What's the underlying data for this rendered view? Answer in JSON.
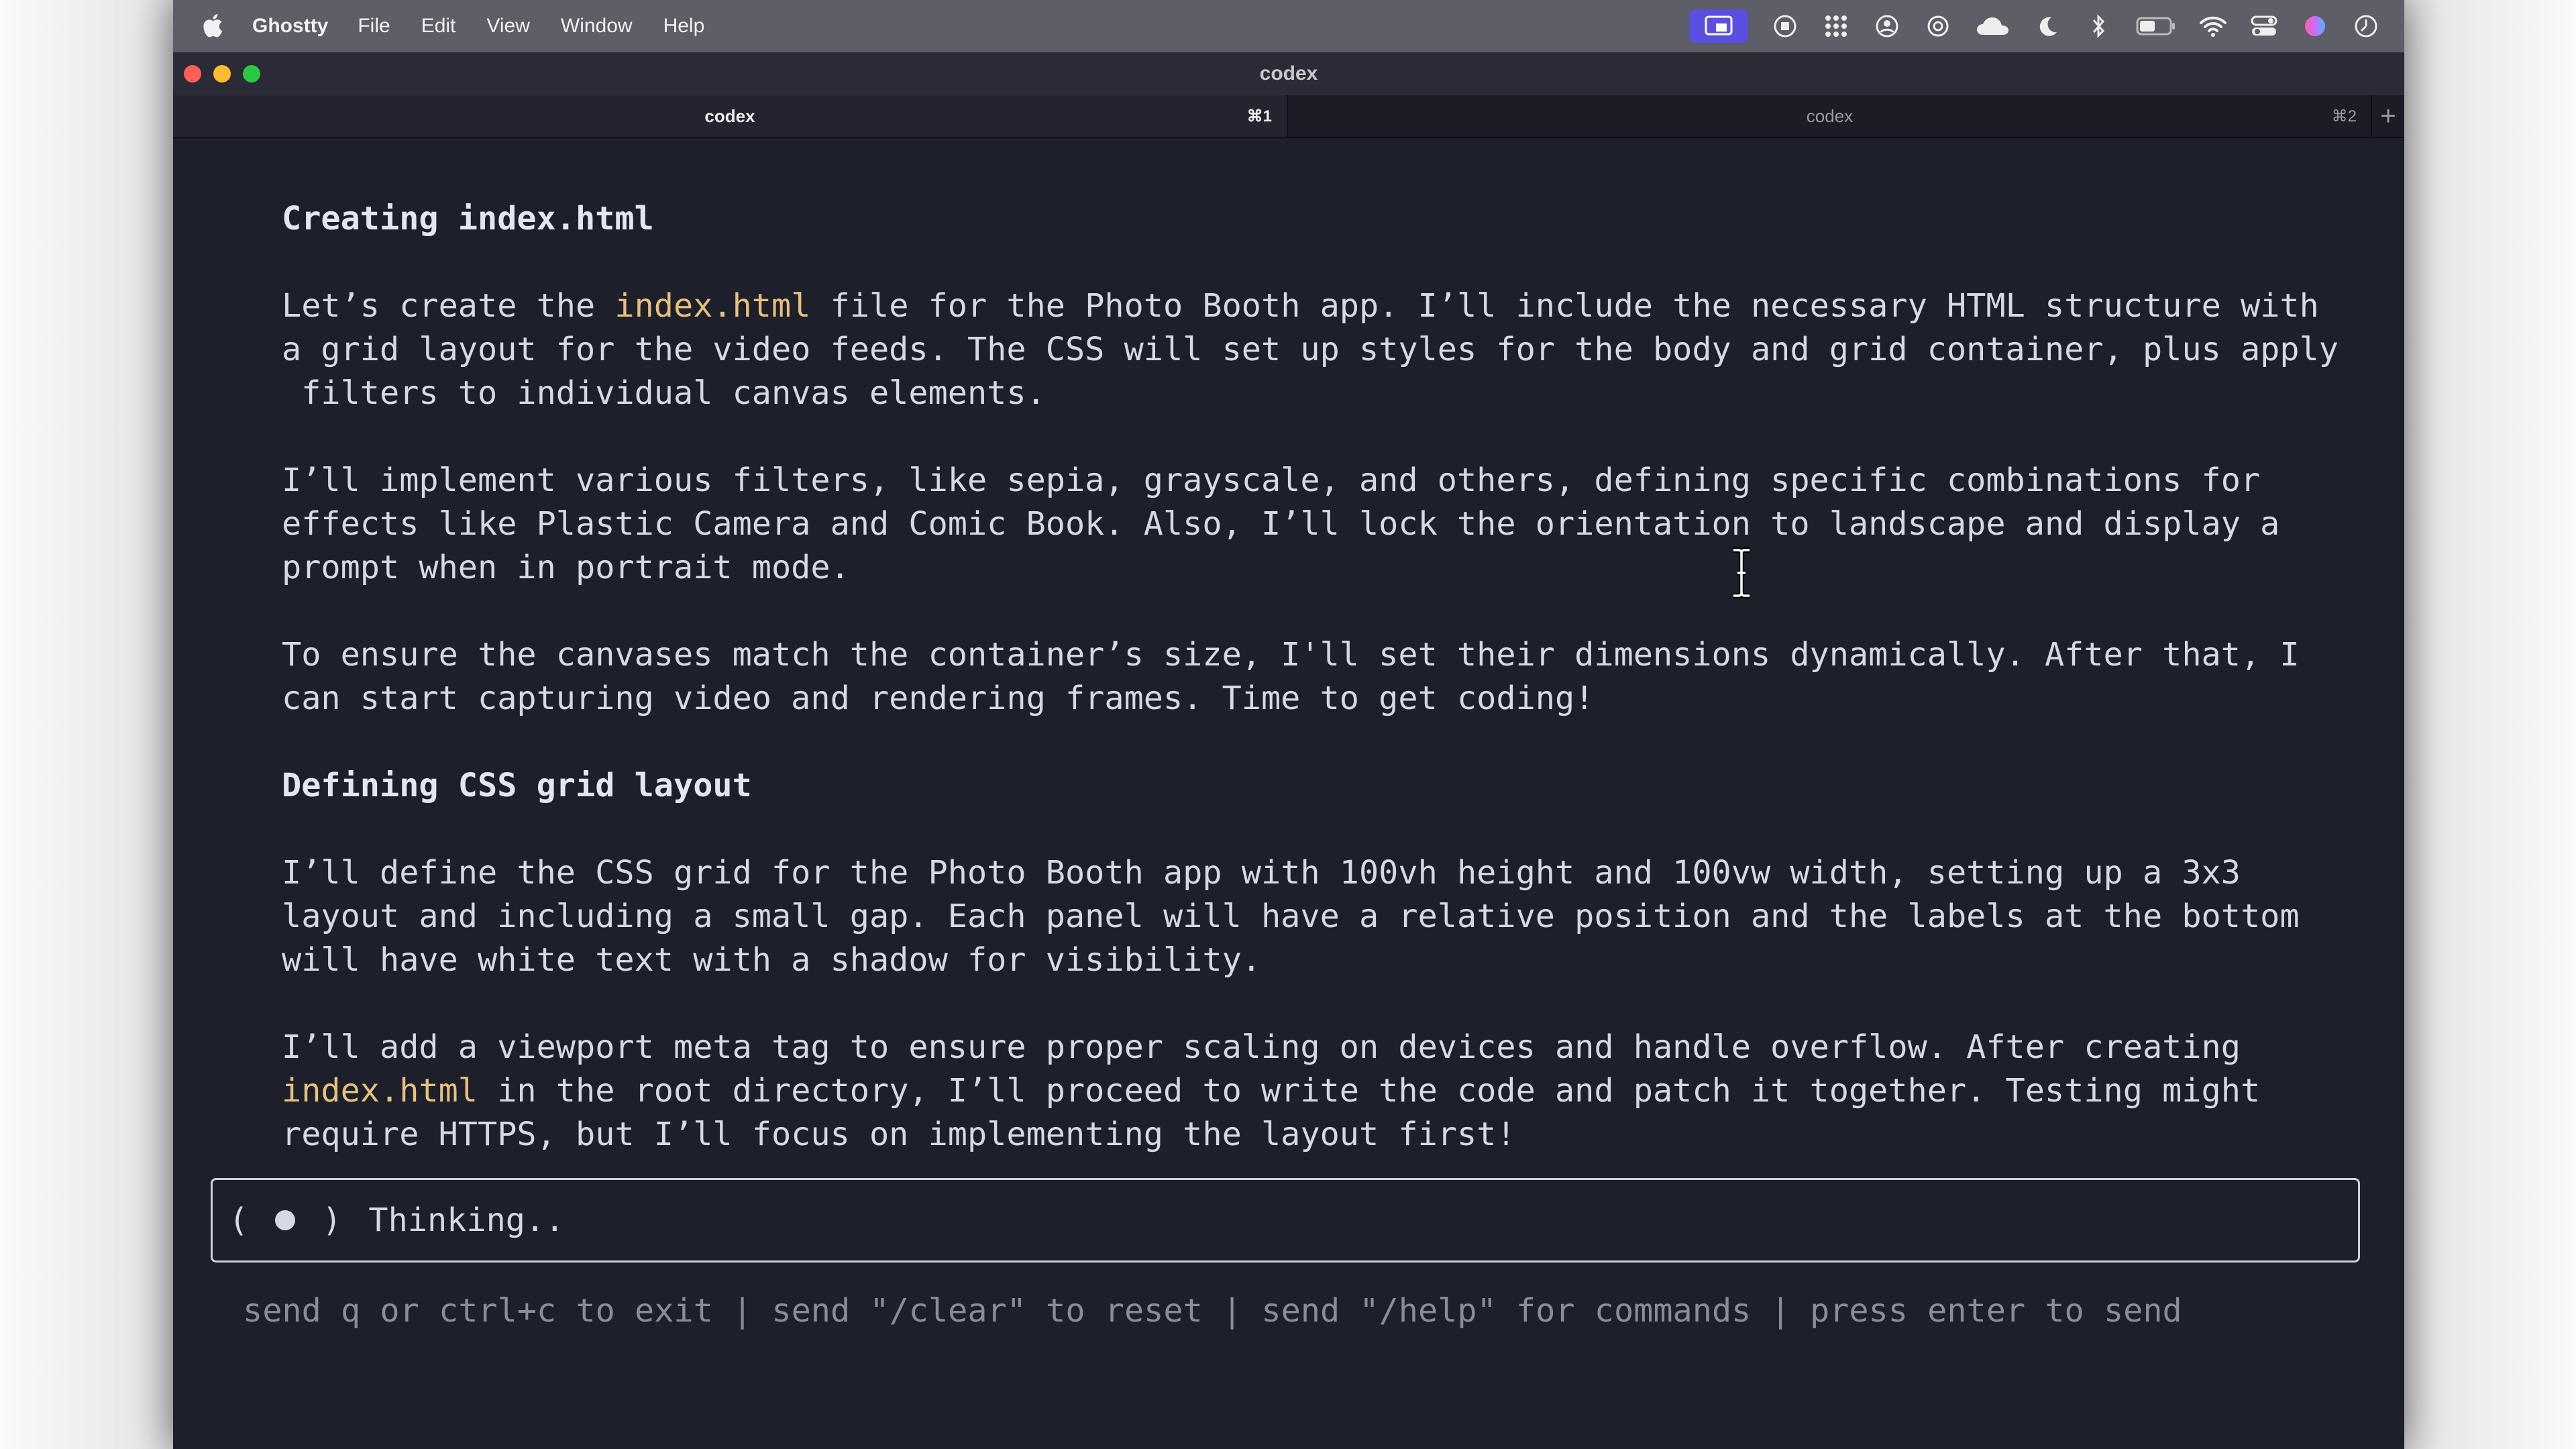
{
  "menubar": {
    "app_name": "Ghostty",
    "items": [
      "File",
      "Edit",
      "View",
      "Window",
      "Help"
    ]
  },
  "window": {
    "title": "codex"
  },
  "tabs": [
    {
      "label": "codex",
      "shortcut": "⌘1",
      "active": true
    },
    {
      "label": "codex",
      "shortcut": "⌘2",
      "active": false
    }
  ],
  "new_tab_label": "+",
  "terminal": {
    "heading1": "Creating index.html",
    "p1_pre": "Let’s create the ",
    "p1_file": "index.html",
    "p1_post": " file for the Photo Booth app. I’ll include the necessary HTML structure with\na grid layout for the video feeds. The CSS will set up styles for the body and grid container, plus apply\n filters to individual canvas elements.",
    "p2": "I’ll implement various filters, like sepia, grayscale, and others, defining specific combinations for\neffects like Plastic Camera and Comic Book. Also, I’ll lock the orientation to landscape and display a\nprompt when in portrait mode.",
    "p3": "To ensure the canvases match the container’s size, I'll set their dimensions dynamically. After that, I\ncan start capturing video and rendering frames. Time to get coding!",
    "heading2": "Defining CSS grid layout",
    "p4": "I’ll define the CSS grid for the Photo Booth app with 100vh height and 100vw width, setting up a 3x3\nlayout and including a small gap. Each panel will have a relative position and the labels at the bottom\nwill have white text with a shadow for visibility.",
    "p5_pre": "I’ll add a viewport meta tag to ensure proper scaling on devices and handle overflow. After creating\n",
    "p5_file": "index.html",
    "p5_post": " in the root directory, I’ll proceed to write the code and patch it together. Testing might\nrequire HTTPS, but I’ll focus on implementing the layout first!",
    "status_open": "(",
    "status_close": ")",
    "status_label": "Thinking..",
    "hint": "send q or ctrl+c to exit | send \"/clear\" to reset | send \"/help\" for commands | press enter to send"
  },
  "colors": {
    "terminal_bg": "#1d1f2b",
    "text": "#d6d8e2",
    "filename_highlight": "#e6c07b",
    "hint": "#8a8c98",
    "close": "#ff5f57",
    "minimize": "#febc2e",
    "zoom": "#28c840"
  },
  "icons": [
    "apple-icon",
    "screen-share-icon",
    "record-icon",
    "grid-icon",
    "contact-icon",
    "openai-icon",
    "cloud-icon",
    "moon-icon",
    "bluetooth-icon",
    "battery-icon",
    "wifi-icon",
    "control-center-icon",
    "siri-icon",
    "clock-icon",
    "text-cursor-icon"
  ]
}
